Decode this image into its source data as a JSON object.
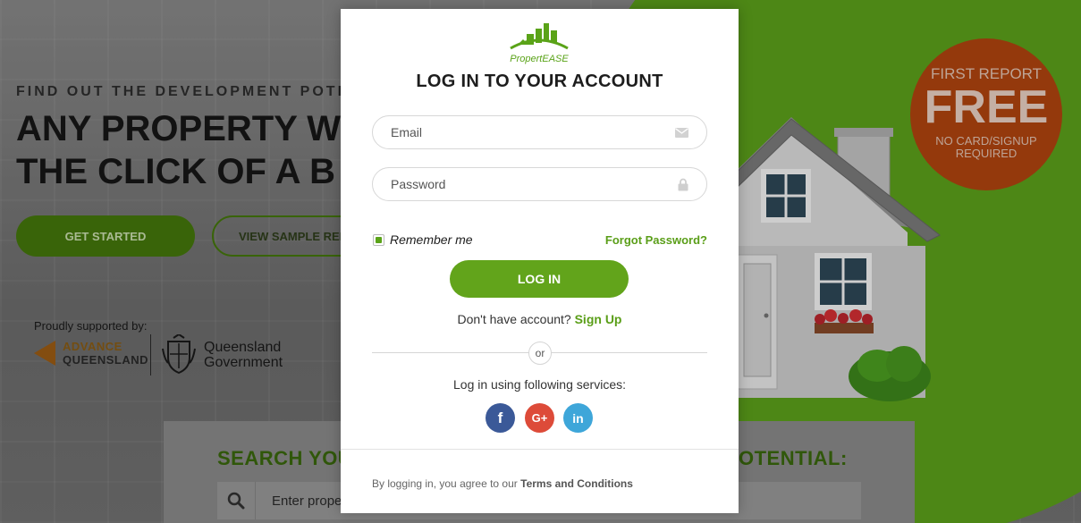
{
  "background": {
    "kicker": "FIND OUT THE DEVELOPMENT POTEN",
    "title_line1": "ANY PROPERTY W",
    "title_line2": "THE CLICK OF A B",
    "get_started_label": "GET STARTED",
    "view_sample_label": "VIEW SAMPLE REP",
    "supported_label": "Proudly supported by:",
    "advance_qld_line1": "ADVANCE",
    "advance_qld_line2": "QUEENSLAND",
    "qld_gov_line1": "Queensland",
    "qld_gov_line2": "Government",
    "search_heading_left": "SEARCH YOU",
    "search_heading_right": "OTENTIAL:",
    "search_placeholder": "Enter prope",
    "first_report": {
      "line1": "FIRST REPORT",
      "line2": "FREE",
      "line3a": "NO CARD/SIGNUP",
      "line3b": "REQUIRED"
    },
    "colors": {
      "green": "#5ea51c",
      "badge": "#b5460f"
    }
  },
  "modal": {
    "brand_name": "PropertEASE",
    "title": "LOG IN TO YOUR ACCOUNT",
    "email_placeholder": "Email",
    "email_icon": "envelope-icon",
    "password_placeholder": "Password",
    "password_icon": "lock-icon",
    "remember_label": "Remember me",
    "remember_checked": true,
    "forgot_label": "Forgot Password?",
    "login_label": "LOG IN",
    "no_account_text": "Don't have account?",
    "signup_label": "Sign Up",
    "or_label": "or",
    "services_label": "Log in using following services:",
    "social": [
      {
        "name": "facebook",
        "glyph": "f"
      },
      {
        "name": "google-plus",
        "glyph": "G+"
      },
      {
        "name": "linkedin",
        "glyph": "in"
      }
    ],
    "terms_prefix": "By logging in, you agree to our",
    "terms_link": "Terms and Conditions",
    "accent_color": "#62a41b"
  }
}
